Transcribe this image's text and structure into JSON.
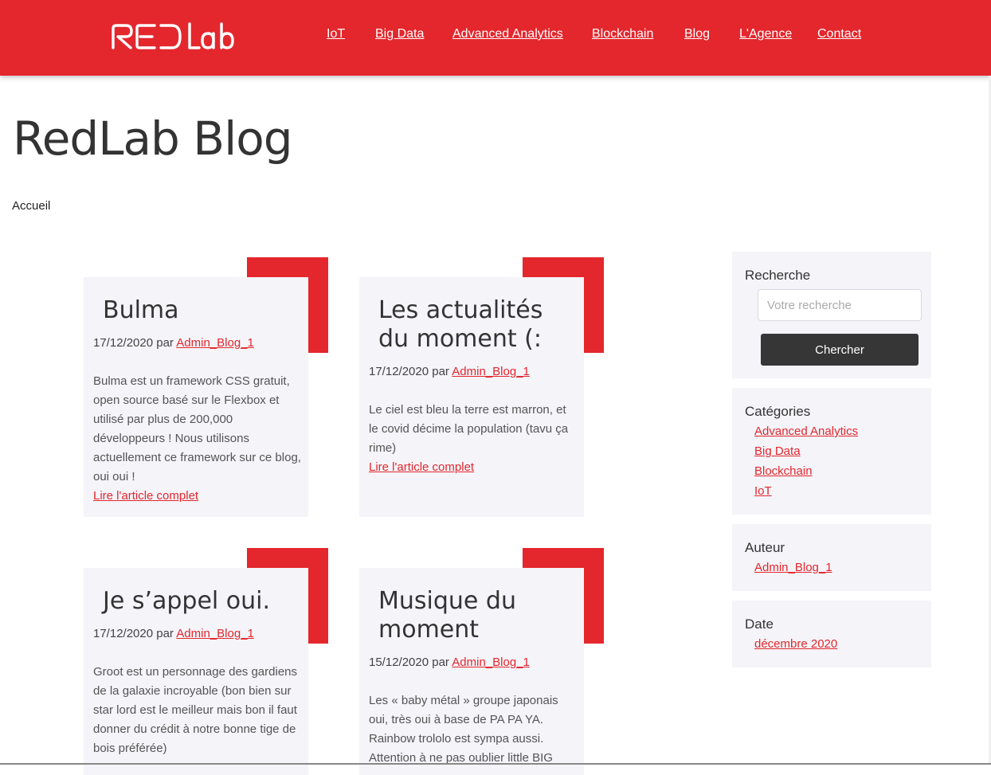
{
  "brand": {
    "logo_text": "RED Lab",
    "accent": "#e3272d"
  },
  "nav": [
    "IoT",
    "Big Data",
    "Advanced Analytics",
    "Blockchain",
    "Blog",
    "L'Agence",
    "Contact"
  ],
  "page": {
    "title": "RedLab Blog",
    "breadcrumb": "Accueil"
  },
  "posts": [
    {
      "title": "Bulma",
      "date": "17/12/2020",
      "by": "par",
      "author": "Admin_Blog_1",
      "excerpt": "Bulma est un framework CSS gratuit, open source basé sur le Flexbox et utilisé par plus de 200,000 développeurs ! Nous utilisons actuellement ce framework sur ce blog, oui oui !",
      "more": "Lire l'article complet"
    },
    {
      "title": "Les actualités du moment (:",
      "date": "17/12/2020",
      "by": "par",
      "author": "Admin_Blog_1",
      "excerpt": "Le ciel est bleu la terre est marron, et le covid décime la population (tavu ça rime)",
      "more": "Lire l'article complet"
    },
    {
      "title": "Je s’appel oui.",
      "date": "17/12/2020",
      "by": "par",
      "author": "Admin_Blog_1",
      "excerpt": "Groot est un personnage des gardiens de la galaxie incroyable (bon bien sur star lord est le meilleur mais bon il faut donner du crédit à notre bonne tige de bois préférée)",
      "more": ""
    },
    {
      "title": "Musique du moment",
      "date": "15/12/2020",
      "by": "par",
      "author": "Admin_Blog_1",
      "excerpt": "Les « baby métal » groupe japonais oui, très oui à base de PA PA YA. Rainbow trololo est sympa aussi. Attention à ne pas oublier little BIG",
      "more": ""
    }
  ],
  "sidebar": {
    "search": {
      "heading": "Recherche",
      "placeholder": "Votre recherche",
      "button": "Chercher"
    },
    "categories": {
      "heading": "Catégories",
      "items": [
        "Advanced Analytics",
        "Big Data",
        "Blockchain",
        "IoT"
      ]
    },
    "author": {
      "heading": "Auteur",
      "items": [
        "Admin_Blog_1"
      ]
    },
    "date": {
      "heading": "Date",
      "items": [
        "décembre 2020"
      ]
    }
  }
}
